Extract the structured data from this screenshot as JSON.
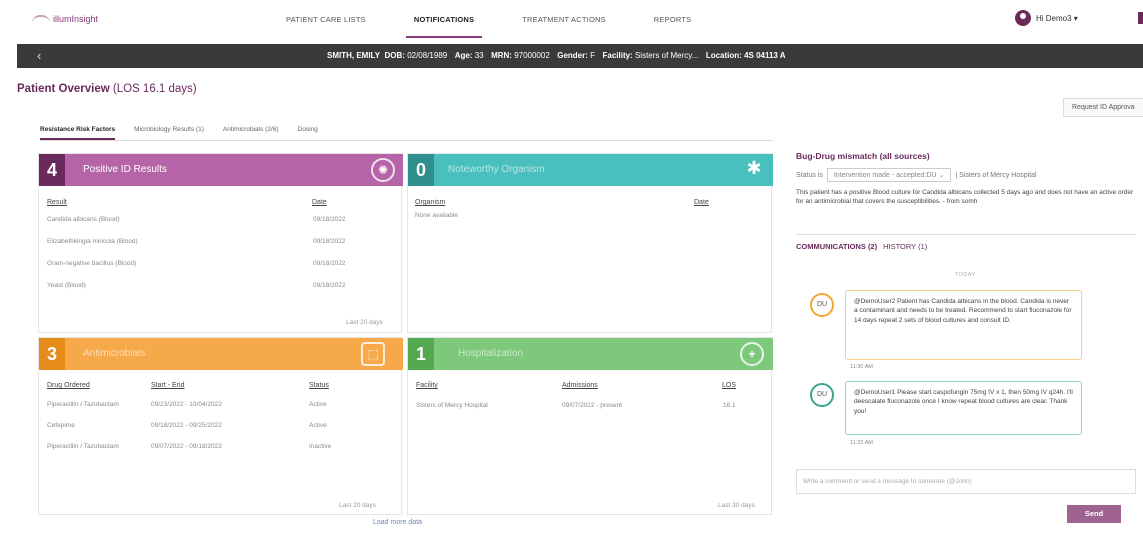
{
  "nav": {
    "logo": "illumInsight",
    "items": [
      "PATIENT CARE LISTS",
      "NOTIFICATIONS",
      "TREATMENT ACTIONS",
      "REPORTS"
    ],
    "user": "Hi Demo3 ▾"
  },
  "patient": {
    "name": "SMITH, EMILY",
    "dob_label": "DOB:",
    "dob": "02/08/1989",
    "age_label": "Age:",
    "age": "33",
    "mrn_label": "MRN:",
    "mrn": "97000002",
    "gender_label": "Gender:",
    "gender": "F",
    "facility_label": "Facility:",
    "facility": "Sisters of Mercy...",
    "location_label": "Location:",
    "location": "4S 04113 A"
  },
  "overview": {
    "title": "Patient Overview",
    "los": "(LOS 16.1 days)",
    "request_btn": "Request ID Approva"
  },
  "tabs": [
    "Resistance Risk Factors",
    "Microbiology Results (1)",
    "Antimicrobials (2/6)",
    "Dosing"
  ],
  "cards": {
    "positive": {
      "count": "4",
      "title": "Positive ID Results",
      "cols": [
        "Result",
        "Date"
      ],
      "rows": [
        [
          "Candida albicans (Blood)",
          "09/18/2022"
        ],
        [
          "Elizabethkingia miricola (Blood)",
          "09/18/2022"
        ],
        [
          "Gram-negative bacillus (Blood)",
          "09/18/2022"
        ],
        [
          "Yeast (Blood)",
          "09/18/2022"
        ]
      ],
      "footer": "Last 20 days"
    },
    "noteworthy": {
      "count": "0",
      "title": "Noteworthy Organism",
      "cols": [
        "Organism",
        "Date"
      ],
      "rows": [
        [
          "None available",
          ""
        ]
      ]
    },
    "antimicrobials": {
      "count": "3",
      "title": "Antimicrobials",
      "cols": [
        "Drug Ordered",
        "Start - End",
        "Status"
      ],
      "rows": [
        [
          "Piperacillin / Tazobactam",
          "09/23/2022 - 10/04/2022",
          "Active"
        ],
        [
          "Cefepime",
          "09/18/2022 - 09/25/2022",
          "Active"
        ],
        [
          "Piperacillin / Tazobactam",
          "09/07/2022 - 09/18/2022",
          "Inactive"
        ]
      ],
      "footer": "Last 20 days"
    },
    "hospitalization": {
      "count": "1",
      "title": "Hospitalization",
      "cols": [
        "Facility",
        "Admissions",
        "LOS"
      ],
      "rows": [
        [
          "Sisters of Mercy Hospital",
          "09/07/2022 - present",
          "16.1"
        ]
      ],
      "footer": "Last 30 days"
    },
    "load_more": "Load more data"
  },
  "right": {
    "title": "Bug-Drug mismatch (all sources)",
    "status_label": "Status is",
    "status_value": "Intervention made - accepted:DU",
    "status_facility": "| Sisters of Mercy Hospital",
    "description": "This patient has a positive Blood culture for Candida albicans collected 5 days ago and does not have an active order for an antimicrobial that covers the susceptibilities. - from somh",
    "comm_tab": "COMMUNICATIONS (2)",
    "history_tab": "HISTORY (1)",
    "today": "TODAY",
    "messages": [
      {
        "avatar": "DU",
        "text": "@DemoUser2 Patient has Candida albicans in the blood. Candida is never a contaminant and needs to be treated. Recommend to start fluconazole for 14 days repeat 2 sets of blood cultures and consult ID.",
        "time": "11:30 AM",
        "color": "#f0a830"
      },
      {
        "avatar": "DU",
        "text": "@DemoUser1 Please start caspofungin 75mg IV x 1, then 50mg IV q24h. I'll deescalate fluconazole once I know repeat blood cultures are clear. Thank you!",
        "time": "11:32 AM",
        "color": "#3aa58c"
      }
    ],
    "compose_placeholder": "Write a comment or send a message to someone (@John)",
    "send": "Send"
  },
  "colors": {
    "brand": "#6b2a5c",
    "positive": "#b565a7",
    "noteworthy": "#49c0bd",
    "antimicrobials": "#f5a94a",
    "hospitalization": "#7dc87a"
  }
}
